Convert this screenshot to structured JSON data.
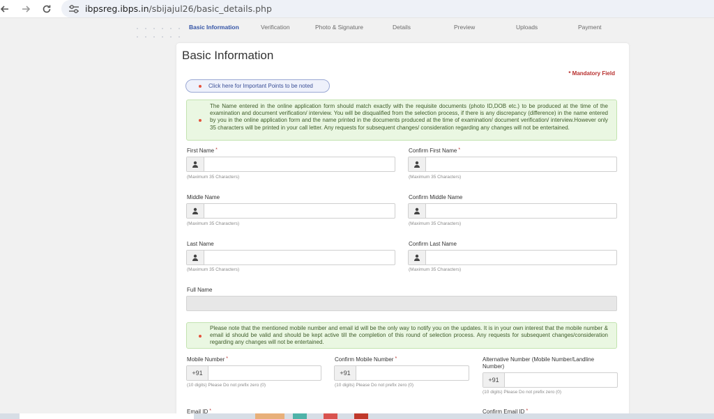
{
  "browser": {
    "url_host": "ibpsreg.ibps.in",
    "url_path": "/sbijajul26/basic_details.php"
  },
  "steps": [
    {
      "label": "Basic Information",
      "active": true
    },
    {
      "label": "Verification",
      "active": false
    },
    {
      "label": "Photo & Signature",
      "active": false
    },
    {
      "label": "Details",
      "active": false
    },
    {
      "label": "Preview",
      "active": false
    },
    {
      "label": "Uploads",
      "active": false
    },
    {
      "label": "Payment",
      "active": false
    }
  ],
  "page": {
    "title": "Basic Information",
    "mandatory": "* Mandatory Field",
    "important_points_button": "Click here for Important Points to be noted",
    "name_notice": "The Name entered in the online application form should match exactly with the requisite documents (photo ID,DOB etc.) to be produced at the time of the examination and document verification/ interview. You will be disqualified from the selection process, if there is any discrepancy (difference) in the name entered by you in the online application form and the name printed in the documents produced at the time of examination/ document verification/ interview.However only 35 characters will be printed in your call letter. Any requests for subsequent changes/ consideration regarding any changes will not be entertained.",
    "contact_notice": "Please note that the mentioned mobile number and email id will be the only way to notify you on the updates. It is in your own interest that the mobile number & email id should be valid and should be kept active till the completion of this round of selection process. Any requests for subsequent changes/consideration regarding any changes will not be entertained."
  },
  "form": {
    "first_name": {
      "label": "First Name",
      "required": "*",
      "hint": "(Maximum 35 Characters)",
      "value": ""
    },
    "confirm_first_name": {
      "label": "Confirm First Name",
      "required": "*",
      "hint": "(Maximum 35 Characters)",
      "value": ""
    },
    "middle_name": {
      "label": "Middle Name",
      "hint": "(Maximum 35 Characters)",
      "value": ""
    },
    "confirm_middle_name": {
      "label": "Confirm Middle Name",
      "hint": "(Maximum 35 Characters)",
      "value": ""
    },
    "last_name": {
      "label": "Last Name",
      "hint": "(Maximum 35 Characters)",
      "value": ""
    },
    "confirm_last_name": {
      "label": "Confirm Last Name",
      "hint": "(Maximum 35 Characters)",
      "value": ""
    },
    "full_name": {
      "label": "Full Name",
      "value": ""
    },
    "mobile": {
      "label": "Mobile Number",
      "required": "*",
      "code": "+91",
      "hint": "(10 digits) Please Do not prefix zero (0)",
      "value": ""
    },
    "confirm_mobile": {
      "label": "Confirm Mobile Number",
      "required": "*",
      "code": "+91",
      "hint": "(10 digits) Please Do not prefix zero (0)",
      "value": ""
    },
    "alternative_number": {
      "label_line1": "Alternative Number (Mobile Number/Landline",
      "label_line2": "Number)",
      "code": "+91",
      "hint": "(10 digits) Please Do not prefix zero (0)",
      "value": ""
    },
    "email": {
      "label": "Email ID",
      "required": "*"
    },
    "confirm_email": {
      "label": "Confirm Email ID",
      "required": "*"
    }
  },
  "colors": {
    "accent": "#3454a6",
    "required": "#b8312f",
    "notice_bg": "#eaf7e2",
    "notice_text": "#3d5b28"
  }
}
